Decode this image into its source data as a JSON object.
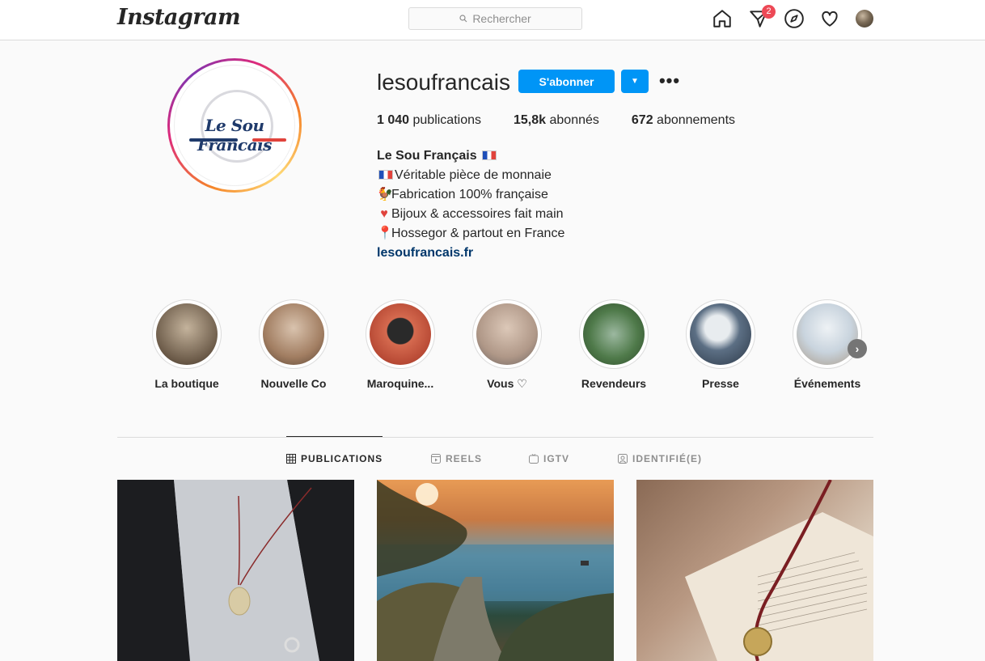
{
  "nav": {
    "logo": "Instagram",
    "search_placeholder": "Rechercher",
    "notification_count": "2",
    "icons": [
      "home-icon",
      "direct-icon",
      "explore-icon",
      "heart-icon",
      "profile-avatar"
    ]
  },
  "profile": {
    "username": "lesoufrancais",
    "follow_label": "S'abonner",
    "more_label": "•••",
    "avatar_text": "Le Sou Francais",
    "stats": [
      {
        "count": "1 040",
        "label": "publications"
      },
      {
        "count": "15,8k",
        "label": "abonnés"
      },
      {
        "count": "672",
        "label": "abonnements"
      }
    ],
    "bio": {
      "name": "Le Sou Français",
      "line1": "Véritable pièce de monnaie",
      "line2": "Fabrication 100% française",
      "line3": "Bijoux & accessoires fait main",
      "line4": "Hossegor & partout en France",
      "link": "lesoufrancais.fr"
    }
  },
  "highlights": [
    {
      "label": "La boutique",
      "color": "#8a7a6a"
    },
    {
      "label": "Nouvelle Co",
      "color": "#b9957b"
    },
    {
      "label": "Maroquine...",
      "color": "#c5523f"
    },
    {
      "label": "Vous ♡",
      "color": "#b7a69a"
    },
    {
      "label": "Revendeurs",
      "color": "#4f7a4a"
    },
    {
      "label": "Presse",
      "color": "#3d4c5e"
    },
    {
      "label": "Événements",
      "color": "#c9d4de"
    }
  ],
  "tabs": [
    {
      "label": "PUBLICATIONS",
      "active": true
    },
    {
      "label": "REELS",
      "active": false
    },
    {
      "label": "IGTV",
      "active": false
    },
    {
      "label": "IDENTIFIÉ(E)",
      "active": false
    }
  ],
  "colors": {
    "accent": "#0095f6",
    "badge": "#ed4956",
    "link": "#00376b"
  }
}
